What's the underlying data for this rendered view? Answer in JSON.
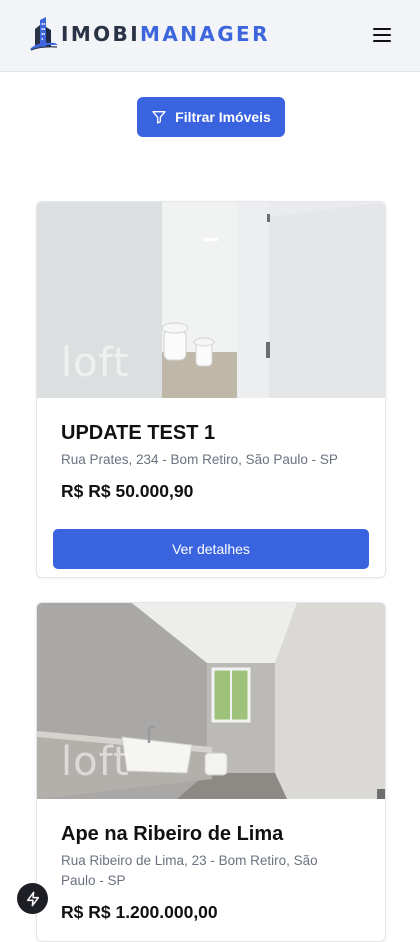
{
  "header": {
    "logo_part1": "IMOBI",
    "logo_part2": "MANAGER"
  },
  "filter_button": {
    "label": "Filtrar Imóveis"
  },
  "listings": [
    {
      "title": "UPDATE TEST 1",
      "address": "Rua Prates, 234 - Bom Retiro, São Paulo - SP",
      "price": "R$ R$ 50.000,90",
      "button_label": "Ver detalhes",
      "watermark": "loft"
    },
    {
      "title": "Ape na Ribeiro de Lima",
      "address": "Rua Ribeiro de Lima, 23 - Bom Retiro, São Paulo - SP",
      "price": "R$ R$ 1.200.000,00",
      "watermark": "loft"
    }
  ],
  "colors": {
    "primary": "#3a63e0",
    "header_bg": "#f3f4f8",
    "logo_dark": "#2a3245",
    "logo_accent": "#3d66dd"
  },
  "icons": {
    "menu": "hamburger-menu-icon",
    "filter": "filter-funnel-icon",
    "fab": "lightning-bolt-icon"
  }
}
